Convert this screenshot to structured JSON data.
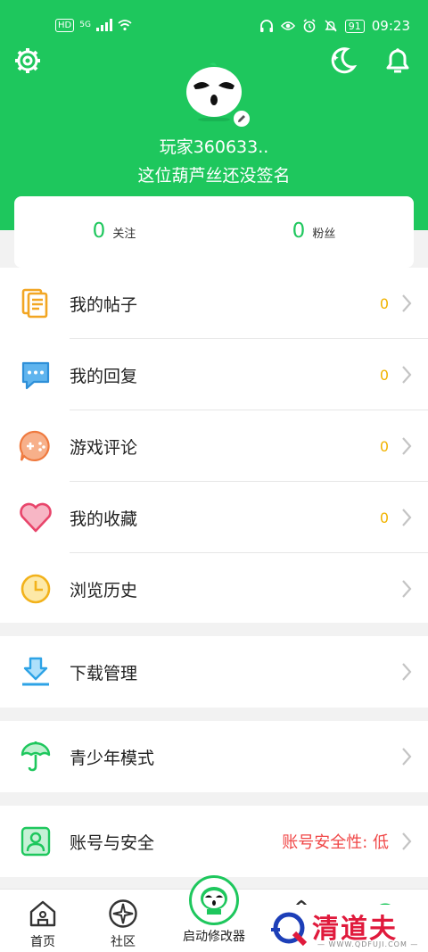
{
  "status_bar": {
    "hd": "HD",
    "network": "5G",
    "time": "09:23",
    "battery": "91"
  },
  "profile": {
    "username": "玩家360633..",
    "signature": "这位葫芦丝还没签名"
  },
  "stats": {
    "follow_count": "0",
    "follow_label": "关注",
    "fans_count": "0",
    "fans_label": "粉丝"
  },
  "menu_group_1": [
    {
      "label": "我的帖子",
      "count": "0",
      "icon": "posts-icon"
    },
    {
      "label": "我的回复",
      "count": "0",
      "icon": "reply-icon"
    },
    {
      "label": "游戏评论",
      "count": "0",
      "icon": "game-comment-icon"
    },
    {
      "label": "我的收藏",
      "count": "0",
      "icon": "heart-icon"
    },
    {
      "label": "浏览历史",
      "count": "",
      "icon": "clock-icon"
    }
  ],
  "menu_download": {
    "label": "下载管理",
    "icon": "download-icon"
  },
  "menu_youth": {
    "label": "青少年模式",
    "icon": "umbrella-icon"
  },
  "menu_account": {
    "label": "账号与安全",
    "status": "账号安全性: 低",
    "icon": "account-icon"
  },
  "tabbar": {
    "home": "首页",
    "community": "社区",
    "launcher": "启动修改器"
  },
  "watermark": {
    "brand": "清道夫",
    "url": "— WWW.QDFUJI.COM —"
  },
  "colors": {
    "brand_green": "#1ec75d",
    "count_yellow": "#f1b300",
    "warning_red": "#f04747"
  }
}
